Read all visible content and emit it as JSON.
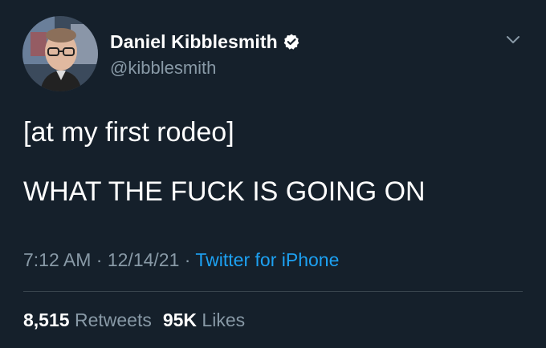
{
  "author": {
    "name": "Daniel Kibblesmith",
    "handle": "@kibblesmith",
    "verified": true
  },
  "icons": {
    "verified": "verified-badge-icon",
    "menu": "chevron-down-icon"
  },
  "tweet": {
    "line1": "[at my first rodeo]",
    "line2": "WHAT THE FUCK IS GOING ON"
  },
  "meta": {
    "time": "7:12 AM",
    "sep1": " · ",
    "date": "12/14/21",
    "sep2": " · ",
    "source": "Twitter for iPhone"
  },
  "stats": {
    "retweets_count": "8,515",
    "retweets_label": "Retweets",
    "likes_count": "95K",
    "likes_label": "Likes"
  },
  "colors": {
    "background": "#15202b",
    "secondary_text": "#8899a6",
    "link": "#1da1f2",
    "divider": "#38444d"
  }
}
